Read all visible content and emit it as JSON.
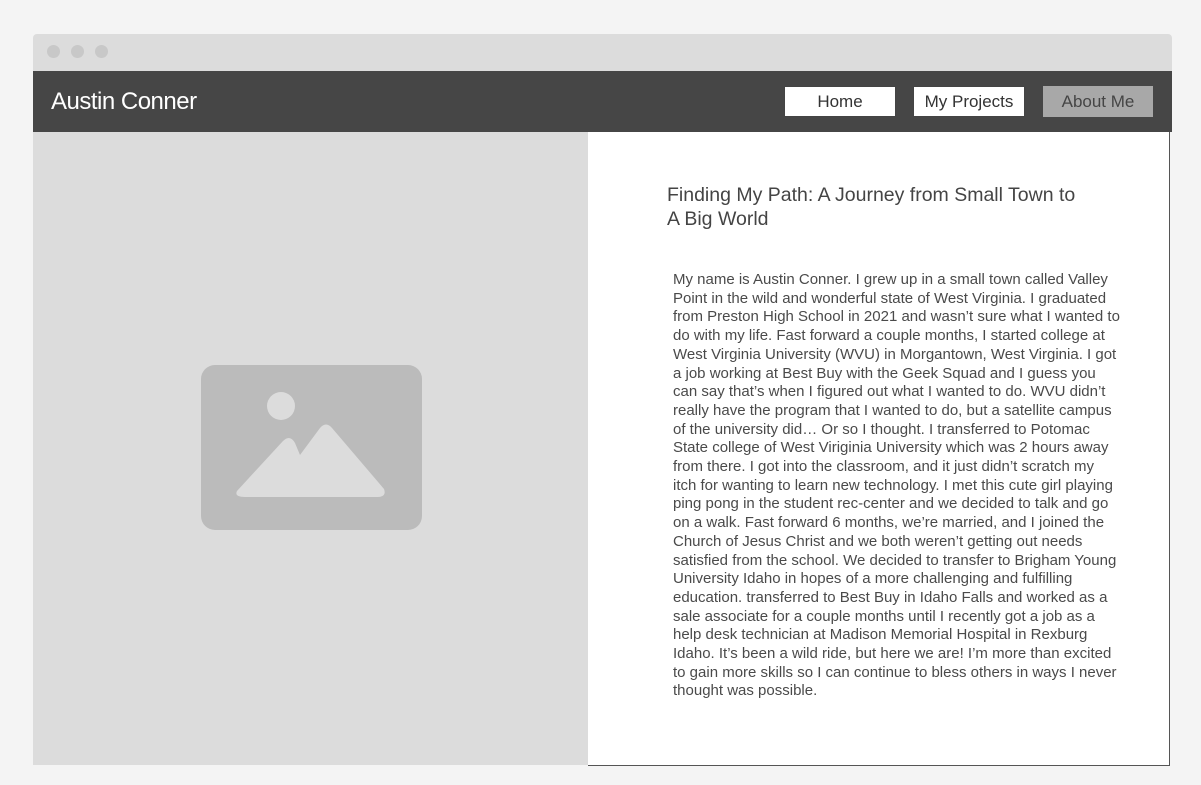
{
  "header": {
    "brand": "Austin Conner"
  },
  "nav": {
    "home": "Home",
    "projects": "My Projects",
    "about": "About Me",
    "active": "About Me"
  },
  "hero_image": {
    "icon": "image-placeholder-icon"
  },
  "article": {
    "title": "Finding My Path: A Journey from Small Town to\nA Big World",
    "body": "My name is Austin Conner. I grew up in a small town called Valley Point in the wild and wonderful state of West Virginia. I graduated from Preston High School in 2021 and wasn’t sure what I wanted to do with my life. Fast forward a couple months, I started college at West Virginia University (WVU) in Morgantown, West Virginia. I got a job working at Best Buy with the Geek Squad and I guess you can say that’s when I figured out what I wanted to do. WVU didn’t really have the program that I wanted to do, but a satellite campus of the university did… Or so I thought. I transferred to Potomac State college of West Viriginia University which was 2 hours away from there. I got into the classroom, and it just didn’t scratch my itch for wanting to learn new technology. I met this cute girl playing ping pong in the student rec-center and we decided to talk and go on a walk. Fast forward 6 months, we’re married, and I joined the Church of Jesus Christ and we both weren’t getting out needs satisfied from the school. We decided to transfer to Brigham Young University Idaho in hopes of a more challenging and fulfilling education. transferred to Best Buy in Idaho Falls and worked as a sale associate for a couple months until I recently got a job as a help desk technician at Madison Memorial Hospital in Rexburg Idaho. It’s been a wild ride, but here we are! I’m more than excited to gain more skills so I can continue to bless others in ways I never thought was possible."
  },
  "colors": {
    "navbar": "#464646",
    "placeholder_bg": "#dcdcdc",
    "placeholder_icon": "#bbbbbb",
    "active_nav": "#a8a8a8"
  }
}
